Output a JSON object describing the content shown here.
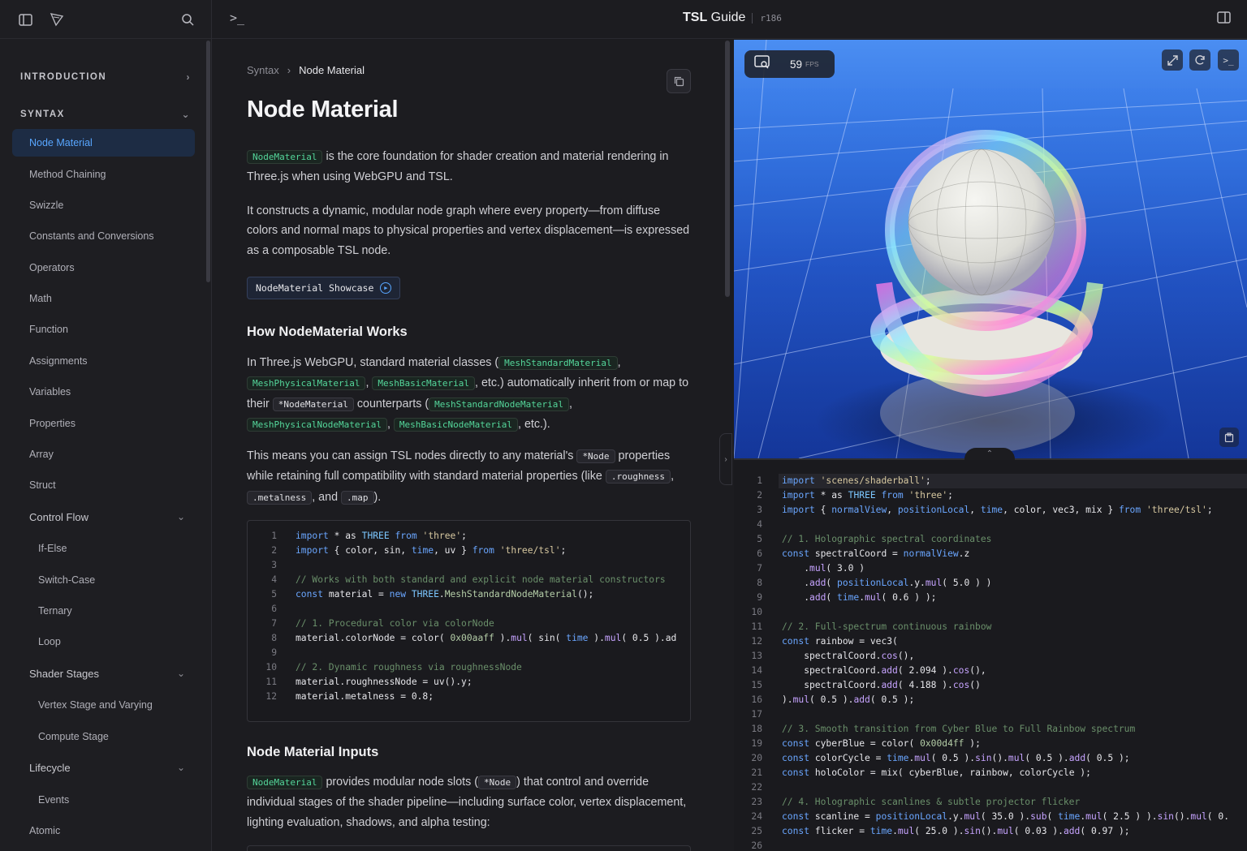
{
  "header": {
    "title_bold": "TSL",
    "title_rest": "Guide",
    "version": "r186"
  },
  "sidebar": {
    "sections": [
      {
        "label": "INTRODUCTION",
        "expanded": false
      },
      {
        "label": "SYNTAX",
        "expanded": true
      }
    ],
    "items": [
      {
        "label": "Node Material",
        "active": true
      },
      {
        "label": "Method Chaining"
      },
      {
        "label": "Swizzle"
      },
      {
        "label": "Constants and Conversions"
      },
      {
        "label": "Operators"
      },
      {
        "label": "Math"
      },
      {
        "label": "Function"
      },
      {
        "label": "Assignments"
      },
      {
        "label": "Variables"
      },
      {
        "label": "Properties"
      },
      {
        "label": "Array"
      },
      {
        "label": "Struct"
      },
      {
        "label": "Control Flow",
        "group": true
      },
      {
        "label": "If-Else",
        "sub": true
      },
      {
        "label": "Switch-Case",
        "sub": true
      },
      {
        "label": "Ternary",
        "sub": true
      },
      {
        "label": "Loop",
        "sub": true
      },
      {
        "label": "Shader Stages",
        "group": true
      },
      {
        "label": "Vertex Stage and Varying",
        "sub": true
      },
      {
        "label": "Compute Stage",
        "sub": true
      },
      {
        "label": "Lifecycle",
        "group": true
      },
      {
        "label": "Events",
        "sub": true
      },
      {
        "label": "Atomic"
      }
    ]
  },
  "content": {
    "breadcrumb": [
      "Syntax",
      "Node Material"
    ],
    "title": "Node Material",
    "p1": {
      "code": "NodeMaterial",
      "text": " is the core foundation for shader creation and material rendering in Three.js when using WebGPU and TSL."
    },
    "p2": "It constructs a dynamic, modular node graph where every property—from diffuse colors and normal maps to physical properties and vertex displacement—is expressed as a composable TSL node.",
    "showcase_label": "NodeMaterial Showcase",
    "h_works": "How NodeMaterial Works",
    "p3": {
      "t1": "In Three.js WebGPU, standard material classes (",
      "c1": "MeshStandardMaterial",
      "t2": ",",
      "c2": "MeshPhysicalMaterial",
      "t3": ",",
      "c3": "MeshBasicMaterial",
      "t4": ", etc.) automatically inherit from or map to their",
      "c4": "*NodeMaterial",
      "t5": "counterparts (",
      "c5": "MeshStandardNodeMaterial",
      "t6": ",",
      "c6": "MeshPhysicalNodeMaterial",
      "t7": ",",
      "c7": "MeshBasicNodeMaterial",
      "t8": ", etc.)."
    },
    "p4": {
      "t1": "This means you can assign TSL nodes directly to any material's",
      "c1": "*Node",
      "t2": "properties while retaining full compatibility with standard material properties (like",
      "c2": ".roughness",
      "t3": ",",
      "c3": ".metalness",
      "t4": ", and",
      "c4": ".map",
      "t5": ")."
    },
    "h_inputs": "Node Material Inputs",
    "p5": {
      "c1": "NodeMaterial",
      "t1": "provides modular node slots (",
      "c2": "*Node",
      "t2": ") that control and override individual stages of the shader pipeline—including surface color, vertex displacement, lighting evaluation, shadows, and alpha testing:"
    },
    "code_lines": [
      "import * as THREE from 'three';",
      "import { color, sin, time, uv } from 'three/tsl';",
      "",
      "// Works with both standard and explicit node material constructors",
      "const material = new THREE.MeshStandardNodeMaterial();",
      "",
      "// 1. Procedural color via colorNode",
      "material.colorNode = color( 0x00aaff ).mul( sin( time ).mul( 0.5 ).ad",
      "",
      "// 2. Dynamic roughness via roughnessNode",
      "material.roughnessNode = uv().y;",
      "material.metalness = 0.8;"
    ]
  },
  "preview": {
    "fps_value": "59",
    "fps_unit": "FPS"
  },
  "editor": {
    "lines": [
      "import 'scenes/shaderball';",
      "import * as THREE from 'three';",
      "import { normalView, positionLocal, time, color, vec3, mix } from 'three/tsl';",
      "",
      "// 1. Holographic spectral coordinates",
      "const spectralCoord = normalView.z",
      "    .mul( 3.0 )",
      "    .add( positionLocal.y.mul( 5.0 ) )",
      "    .add( time.mul( 0.6 ) );",
      "",
      "// 2. Full-spectrum continuous rainbow",
      "const rainbow = vec3(",
      "    spectralCoord.cos(),",
      "    spectralCoord.add( 2.094 ).cos(),",
      "    spectralCoord.add( 4.188 ).cos()",
      ").mul( 0.5 ).add( 0.5 );",
      "",
      "// 3. Smooth transition from Cyber Blue to Full Rainbow spectrum",
      "const cyberBlue = color( 0x00d4ff );",
      "const colorCycle = time.mul( 0.5 ).sin().mul( 0.5 ).add( 0.5 );",
      "const holoColor = mix( cyberBlue, rainbow, colorCycle );",
      "",
      "// 4. Holographic scanlines & subtle projector flicker",
      "const scanline = positionLocal.y.mul( 35.0 ).sub( time.mul( 2.5 ) ).sin().mul( 0.",
      "const flicker = time.mul( 25.0 ).sin().mul( 0.03 ).add( 0.97 );",
      ""
    ]
  }
}
